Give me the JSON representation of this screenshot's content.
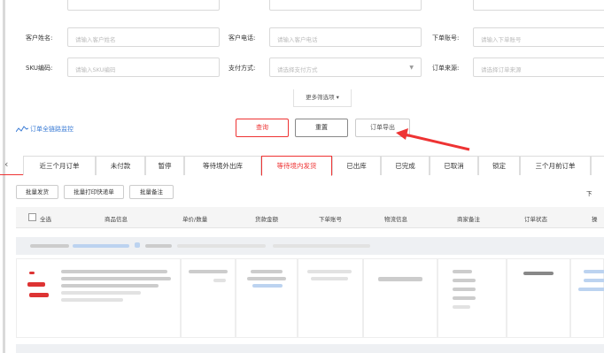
{
  "filters": {
    "customer_name_label": "客户姓名:",
    "customer_name_placeholder": "请输入客户姓名",
    "customer_phone_label": "客户电话:",
    "customer_phone_placeholder": "请输入客户电话",
    "order_account_label": "下单账号:",
    "order_account_placeholder": "请输入下单账号",
    "sku_label": "SKU编码:",
    "sku_placeholder": "请输入SKU编码",
    "payment_label": "支付方式:",
    "payment_placeholder": "请选择支付方式",
    "order_source_label": "订单来源:",
    "order_source_placeholder": "请选择订单来源",
    "more_filters": "更多筛选项 ▾"
  },
  "monitor_link": "订单全链路监控",
  "buttons": {
    "query": "查询",
    "reset": "重置",
    "export": "订单导出"
  },
  "tabs": [
    "近三个月订单",
    "未付款",
    "暂停",
    "等待境外出库",
    "等待境内发货",
    "已出库",
    "已完成",
    "已取消",
    "锁定",
    "三个月前订单"
  ],
  "active_tab": "等待境内发货",
  "batch_actions": [
    "批量发货",
    "批量打印快递单",
    "批量备注"
  ],
  "next_page": "下",
  "table": {
    "select_all": "全选",
    "headers": [
      "商品信息",
      "单价/数量",
      "货款金额",
      "下单账号",
      "物流信息",
      "商家备注",
      "订单状态",
      "操"
    ]
  },
  "colors": {
    "accent": "#e33",
    "link": "#3a7bd5"
  }
}
